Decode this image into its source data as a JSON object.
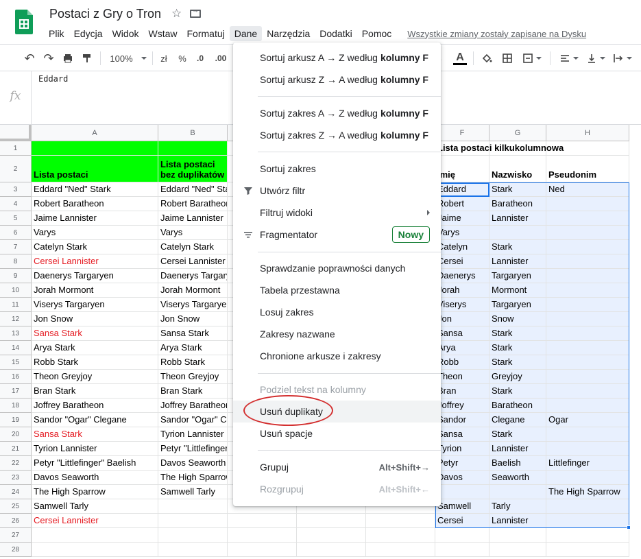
{
  "app": {
    "title": "Postaci z Gry o Tron",
    "menu": [
      "Plik",
      "Edycja",
      "Widok",
      "Wstaw",
      "Formatuj",
      "Dane",
      "Narzędzia",
      "Dodatki",
      "Pomoc"
    ],
    "active_menu": "Dane",
    "saved_status": "Wszystkie zmiany zostały zapisane na Dysku"
  },
  "toolbar": {
    "zoom": "100%",
    "currency": "zł",
    "percent": "%",
    "decrease_decimals": ".0",
    "increase_decimals": ".00",
    "text_color_letter": "A"
  },
  "formula_bar": {
    "fx": "fx",
    "value": "Eddard"
  },
  "columns": [
    "A",
    "B",
    "C",
    "D",
    "E",
    "F",
    "G",
    "H"
  ],
  "rows": [
    "1",
    "2",
    "3",
    "4",
    "5",
    "6",
    "7",
    "8",
    "9",
    "10",
    "11",
    "12",
    "13",
    "14",
    "15",
    "16",
    "17",
    "18",
    "19",
    "20",
    "21",
    "22",
    "23",
    "24",
    "25",
    "26",
    "27",
    "28"
  ],
  "col_a": {
    "header": "Lista postaci",
    "items": [
      "Eddard \"Ned\" Stark",
      "Robert Baratheon",
      "Jaime Lannister",
      "Varys",
      "Catelyn Stark",
      "Cersei Lannister",
      "Daenerys Targaryen",
      "Jorah Mormont",
      "Viserys Targaryen",
      "Jon Snow",
      "Sansa Stark",
      "Arya Stark",
      "Robb Stark",
      "Theon Greyjoy",
      "Bran Stark",
      "Joffrey Baratheon",
      "Sandor \"Ogar\" Clegane",
      "Sansa Stark",
      "Tyrion Lannister",
      "Petyr \"Littlefinger\" Baelish",
      "Davos Seaworth",
      "The High Sparrow",
      "Samwell Tarly",
      "Cersei Lannister"
    ],
    "red_rows": [
      5,
      10,
      17,
      23
    ],
    "red_color": "#e51c23"
  },
  "col_b": {
    "header_line1": "Lista postaci",
    "header_line2": "bez duplikatów",
    "items": [
      "Eddard \"Ned\" Stark",
      "Robert Baratheon",
      "Jaime Lannister",
      "Varys",
      "Catelyn Stark",
      "Cersei Lannister",
      "Daenerys Targaryen",
      "Jorah Mormont",
      "Viserys Targaryen",
      "Jon Snow",
      "Sansa Stark",
      "Arya Stark",
      "Robb Stark",
      "Theon Greyjoy",
      "Bran Stark",
      "Joffrey Baratheon",
      "Sandor \"Ogar\" Clegane",
      "Tyrion Lannister",
      "Petyr \"Littlefinger\" Baelish",
      "Davos Seaworth",
      "The High Sparrow",
      "Samwell Tarly"
    ]
  },
  "right_table": {
    "title": "Lista postaci kilkukolumnowa",
    "headers": [
      "Imię",
      "Nazwisko",
      "Pseudonim"
    ],
    "rows": [
      [
        "Eddard",
        "Stark",
        "Ned"
      ],
      [
        "Robert",
        "Baratheon",
        ""
      ],
      [
        "Jaime",
        "Lannister",
        ""
      ],
      [
        "Varys",
        "",
        ""
      ],
      [
        "Catelyn",
        "Stark",
        ""
      ],
      [
        "Cersei",
        "Lannister",
        ""
      ],
      [
        "Daenerys",
        "Targaryen",
        ""
      ],
      [
        "Jorah",
        "Mormont",
        ""
      ],
      [
        "Viserys",
        "Targaryen",
        ""
      ],
      [
        "Jon",
        "Snow",
        ""
      ],
      [
        "Sansa",
        "Stark",
        ""
      ],
      [
        "Arya",
        "Stark",
        ""
      ],
      [
        "Robb",
        "Stark",
        ""
      ],
      [
        "Theon",
        "Greyjoy",
        ""
      ],
      [
        "Bran",
        "Stark",
        ""
      ],
      [
        "Joffrey",
        "Baratheon",
        ""
      ],
      [
        "Sandor",
        "Clegane",
        "Ogar"
      ],
      [
        "Sansa",
        "Stark",
        ""
      ],
      [
        "Tyrion",
        "Lannister",
        ""
      ],
      [
        "Petyr",
        "Baelish",
        "Littlefinger"
      ],
      [
        "Davos",
        "Seaworth",
        ""
      ],
      [
        "",
        "",
        "The High Sparrow"
      ],
      [
        "Samwell",
        "Tarly",
        ""
      ],
      [
        "Cersei",
        "Lannister",
        ""
      ]
    ]
  },
  "colors": {
    "header_fill": "#00ff00",
    "selection": "#e8f0fe",
    "accent": "#1a73e8",
    "annotation": "#d32f2f",
    "badge": "#188038"
  },
  "data_menu": {
    "sort_sheet_az": "Sortuj arkusz A → Z według",
    "sort_sheet_za": "Sortuj arkusz Z → A według",
    "sort_range_az": "Sortuj zakres A → Z według",
    "sort_range_za": "Sortuj zakres Z → A według",
    "column_f": "kolumny F",
    "sort_range": "Sortuj zakres",
    "create_filter": "Utwórz filtr",
    "filter_views": "Filtruj widoki",
    "slicer": "Fragmentator",
    "slicer_badge": "Nowy",
    "data_validation": "Sprawdzanie poprawności danych",
    "pivot_table": "Tabela przestawna",
    "randomize_range": "Losuj zakres",
    "named_ranges": "Zakresy nazwane",
    "protected_sheets": "Chronione arkusze i zakresy",
    "split_text": "Podziel tekst na kolumny",
    "remove_duplicates": "Usuń duplikaty",
    "trim_whitespace": "Usuń spacje",
    "group": "Grupuj",
    "group_shortcut": "Alt+Shift+→",
    "ungroup": "Rozgrupuj",
    "ungroup_shortcut": "Alt+Shift+←"
  }
}
